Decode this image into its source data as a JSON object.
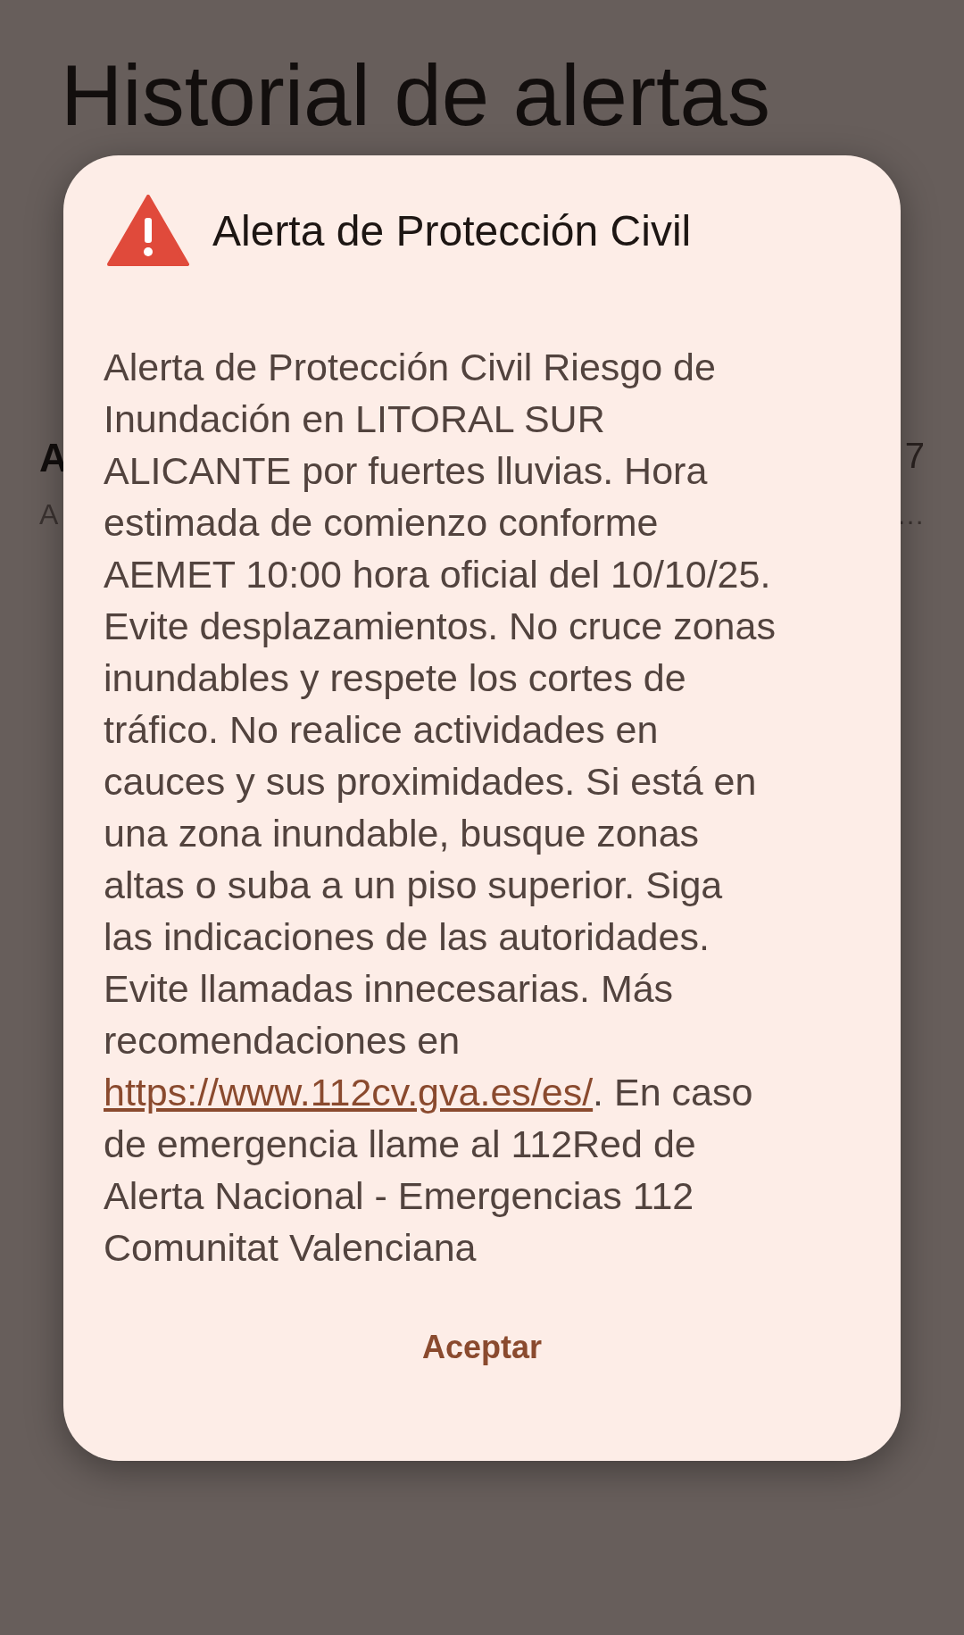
{
  "page": {
    "title": "Historial de alertas",
    "list_item": {
      "title_start": "A",
      "time_end": "7",
      "subtitle_start": "A",
      "subtitle_end": "…"
    }
  },
  "dialog": {
    "title": "Alerta de Protección Civil",
    "message_before": "Alerta de Protección Civil Riesgo de Inundación en LITORAL SUR ALICANTE por fuertes lluvias. Hora estimada de comienzo conforme AEMET 10:00 hora oficial del 10/10/25. Evite desplazamientos. No cruce zonas inundables y respete los cortes de tráfico. No realice actividades en cauces y sus proximidades. Si está en una zona inundable, busque zonas altas o suba a un piso superior. Siga las indicaciones de las autoridades. Evite llamadas innecesarias. Más recomendaciones en ",
    "link": "https://www.112cv.gva.es/es/",
    "message_after": ". En caso de emergencia llame al 112Red de Alerta Nacional - Emergencias 112 Comunitat Valenciana",
    "button": "Aceptar"
  }
}
